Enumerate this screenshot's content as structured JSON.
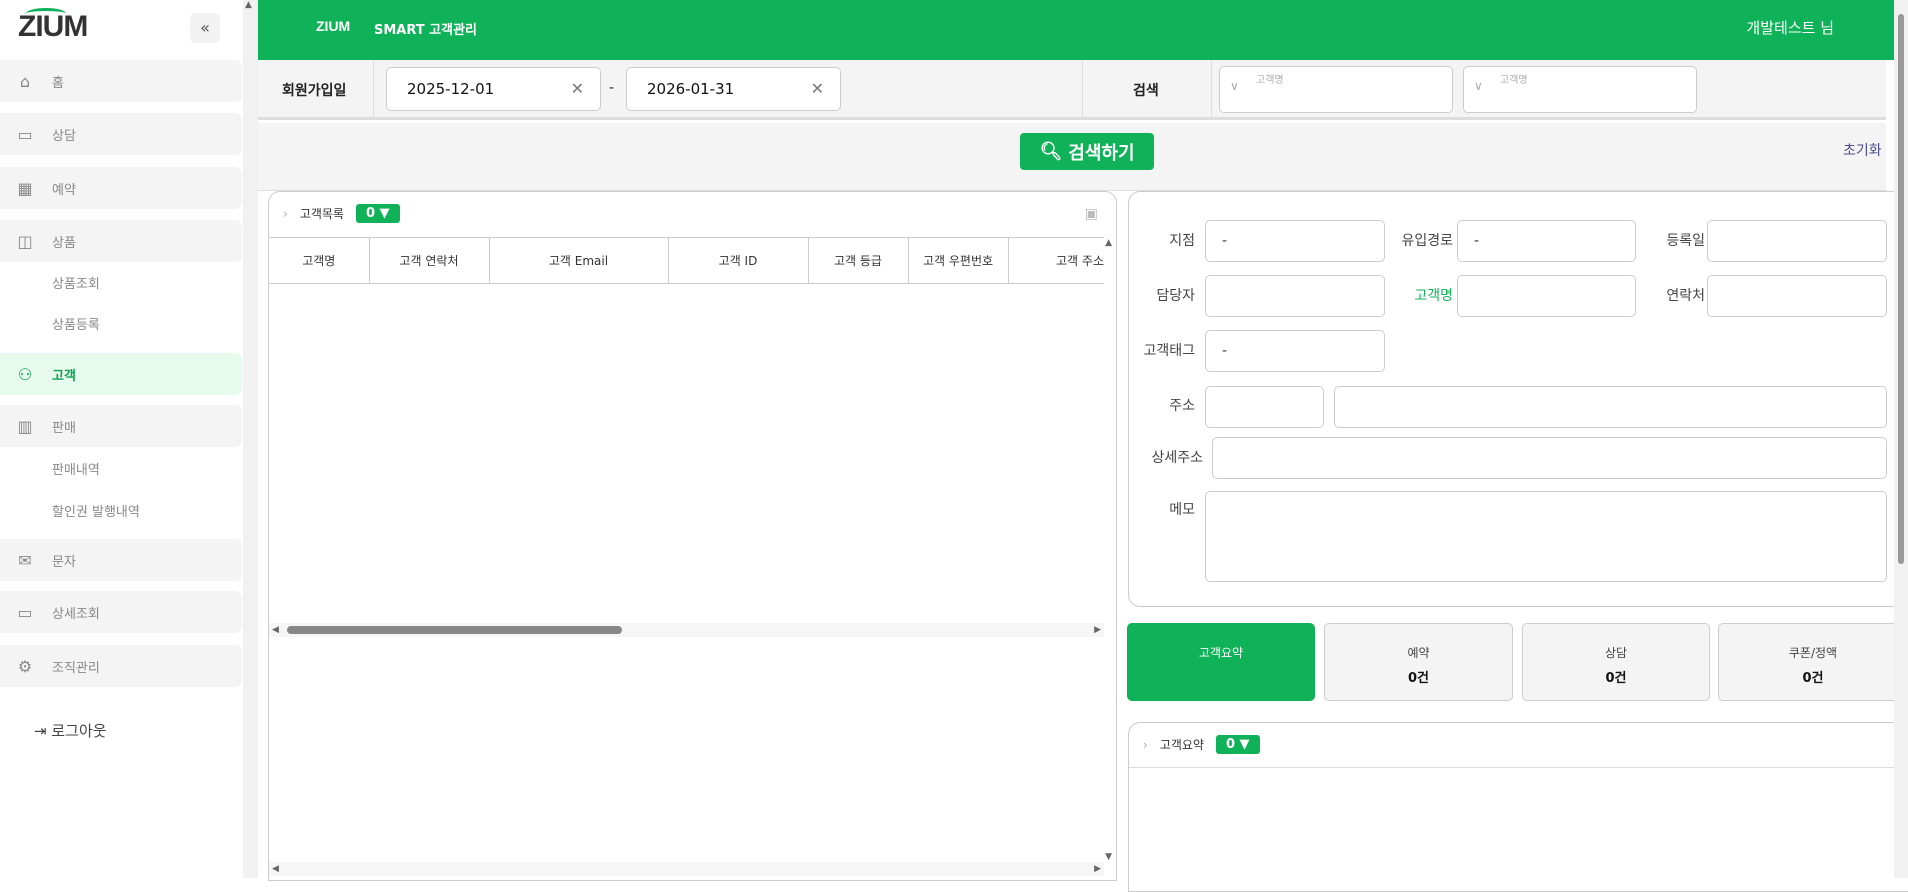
{
  "brand": {
    "logo": "ZIUM",
    "accent": "#10b259"
  },
  "sidebar": {
    "collapse_icon": "double-chevron-left",
    "items": [
      {
        "label": "홈",
        "icon": "home-icon"
      },
      {
        "label": "상담",
        "icon": "chat-icon"
      },
      {
        "label": "예약",
        "icon": "calendar-icon"
      },
      {
        "label": "상품",
        "icon": "bag-icon",
        "children": [
          "상품조회",
          "상품등록"
        ]
      },
      {
        "label": "고객",
        "icon": "users-icon",
        "active": true
      },
      {
        "label": "판매",
        "icon": "chart-icon",
        "children": [
          "판매내역",
          "할인권 발행내역"
        ]
      },
      {
        "label": "문자",
        "icon": "mail-icon"
      },
      {
        "label": "상세조회",
        "icon": "monitor-icon"
      },
      {
        "label": "조직관리",
        "icon": "user-gear-icon"
      }
    ],
    "logout": "로그아웃"
  },
  "header": {
    "logo": "ZIUM",
    "title": "SMART 고객관리",
    "user": "개발테스트 님"
  },
  "filter": {
    "join_date_label": "회원가입일",
    "date_from": "2025-12-01",
    "date_sep": "-",
    "date_to": "2026-01-31",
    "search_label": "검색",
    "select1_placeholder": "고객명",
    "select2_placeholder": "고객명"
  },
  "search_button": "검색하기",
  "reset_link": "초기화",
  "customer_list": {
    "title": "고객목록",
    "count": "0 ▼",
    "columns": [
      "고객명",
      "고객 연락처",
      "고객 Email",
      "고객 ID",
      "고객 등급",
      "고객 우편번호",
      "고객 주소"
    ]
  },
  "detail": {
    "branch_label": "지점",
    "branch": "-",
    "source_label": "유입경로",
    "source": "-",
    "reg_date_label": "등록일",
    "reg_date": "",
    "manager_label": "담당자",
    "manager": "",
    "name_label": "고객명",
    "name": "",
    "phone_label": "연락처",
    "phone": "",
    "tag_label": "고객태그",
    "tag": "-",
    "address_label": "주소",
    "address_detail_label": "상세주소",
    "memo_label": "메모"
  },
  "cards": [
    {
      "label": "고객요약",
      "value": "",
      "active": true
    },
    {
      "label": "예약",
      "value": "0건"
    },
    {
      "label": "상담",
      "value": "0건"
    },
    {
      "label": "쿠폰/정액",
      "value": "0건"
    }
  ],
  "summary": {
    "title": "고객요약",
    "count": "0 ▼"
  }
}
